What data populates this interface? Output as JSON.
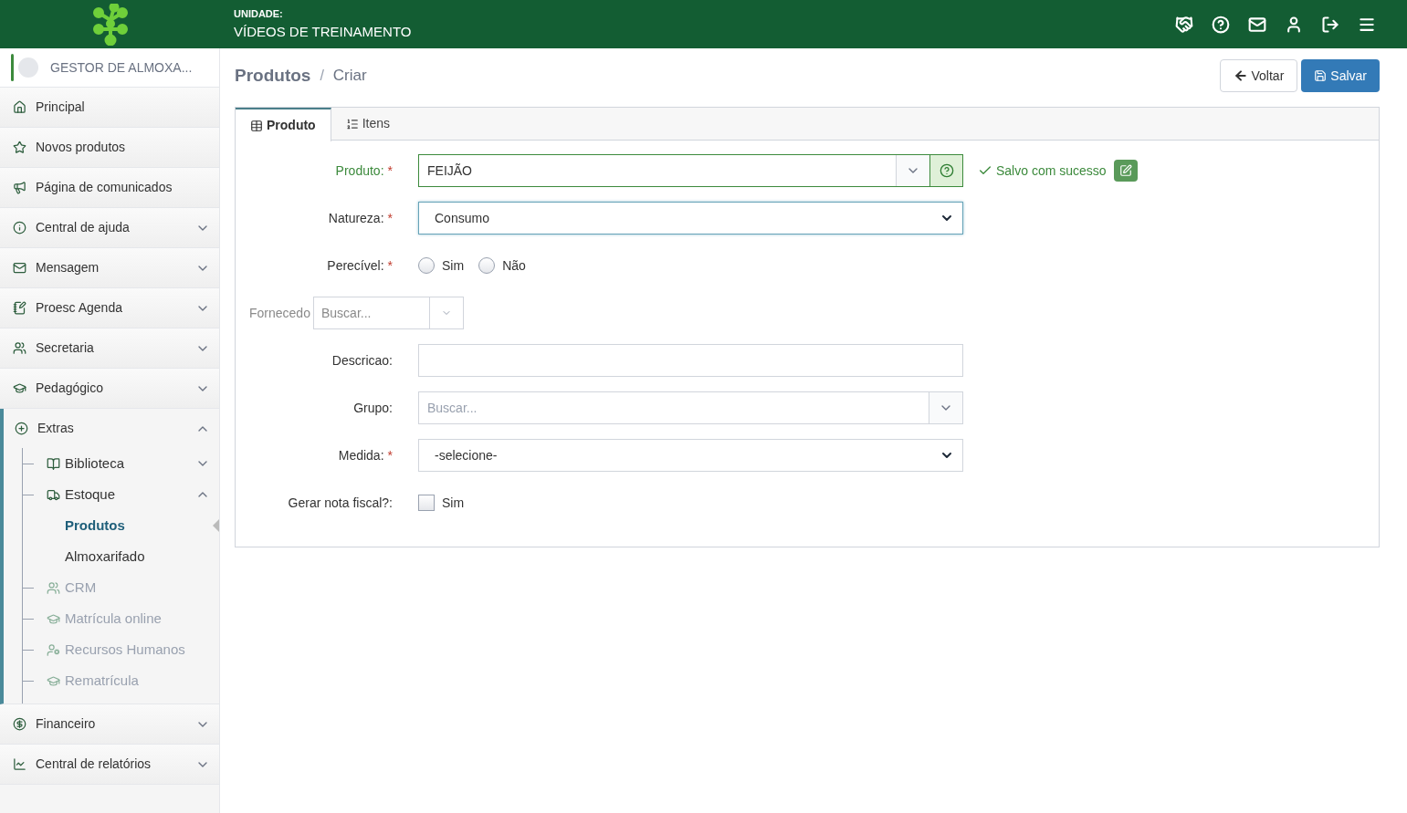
{
  "header": {
    "unit_label": "UNIDADE:",
    "unit_name": "VÍDEOS DE TREINAMENTO"
  },
  "sidebar": {
    "user": "GESTOR DE ALMOXA...",
    "items": [
      {
        "label": "Principal"
      },
      {
        "label": "Novos produtos"
      },
      {
        "label": "Página de comunicados"
      },
      {
        "label": "Central de ajuda",
        "expandable": true,
        "expanded": false
      },
      {
        "label": "Mensagem",
        "expandable": true,
        "expanded": false
      },
      {
        "label": "Proesc Agenda",
        "expandable": true,
        "expanded": false
      },
      {
        "label": "Secretaria",
        "expandable": true,
        "expanded": false
      },
      {
        "label": "Pedagógico",
        "expandable": true,
        "expanded": false
      },
      {
        "label": "Extras",
        "expandable": true,
        "expanded": true,
        "children": [
          {
            "label": "Biblioteca",
            "expandable": true,
            "expanded": false,
            "disabled": false
          },
          {
            "label": "Estoque",
            "expandable": true,
            "expanded": true,
            "disabled": false,
            "children": [
              {
                "label": "Produtos",
                "selected": true
              },
              {
                "label": "Almoxarifado",
                "selected": false
              }
            ]
          },
          {
            "label": "CRM",
            "disabled": true
          },
          {
            "label": "Matrícula online",
            "disabled": true
          },
          {
            "label": "Recursos Humanos",
            "disabled": true
          },
          {
            "label": "Rematrícula",
            "disabled": true
          }
        ]
      },
      {
        "label": "Financeiro",
        "expandable": true,
        "expanded": false
      },
      {
        "label": "Central de relatórios",
        "expandable": true,
        "expanded": false
      }
    ]
  },
  "breadcrumb": [
    "Produtos",
    "/",
    "Criar"
  ],
  "buttons": {
    "back": "Voltar",
    "save": "Salvar"
  },
  "tabs": [
    {
      "label": "Produto",
      "selected": true
    },
    {
      "label": "Itens",
      "selected": false
    }
  ],
  "form": [
    {
      "kind": "search-select",
      "label": "Produto:",
      "required_mark": "*",
      "valid": true,
      "value": "FEIJÃO",
      "status": "Salvo com sucesso"
    },
    {
      "kind": "select",
      "label": "Natureza:",
      "required_mark": "*",
      "focused": true,
      "value": "Consumo"
    },
    {
      "kind": "radio",
      "label": "Perecível:",
      "required_mark": "*",
      "options": [
        {
          "label": "Sim",
          "checked": false
        },
        {
          "label": "Não",
          "checked": false
        }
      ]
    },
    {
      "kind": "overlapped-search",
      "label": "Fornecedo",
      "placeholder": "Buscar..."
    },
    {
      "kind": "text",
      "label": "Descricao:"
    },
    {
      "kind": "search-select",
      "label": "Grupo:",
      "valid": false,
      "placeholder": "Buscar..."
    },
    {
      "kind": "select",
      "label": "Medida:",
      "required_mark": "*",
      "focused": false,
      "value": "-selecione-"
    },
    {
      "kind": "checkbox",
      "label": "Gerar nota fiscal?:",
      "options": [
        {
          "label": "Sim",
          "checked": false
        }
      ]
    }
  ]
}
